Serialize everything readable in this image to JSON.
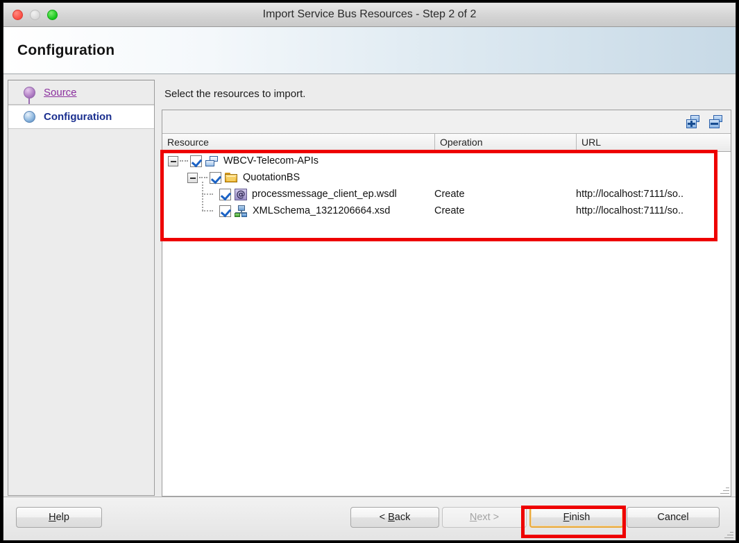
{
  "window": {
    "title": "Import Service Bus Resources - Step 2 of 2",
    "traffic": {
      "close": "close-button",
      "minimize": "minimize-button",
      "maximize": "maximize-button"
    }
  },
  "header": {
    "title": "Configuration"
  },
  "sidebar": {
    "items": [
      {
        "label": "Source",
        "state": "visited",
        "icon": "step-bullet-icon"
      },
      {
        "label": "Configuration",
        "state": "current",
        "icon": "step-bullet-icon"
      }
    ]
  },
  "main": {
    "instruction": "Select the resources to import.",
    "toolbar": [
      {
        "name": "select-all-button",
        "icon": "add-squares-icon",
        "tooltip": "Select All"
      },
      {
        "name": "deselect-all-button",
        "icon": "remove-squares-icon",
        "tooltip": "Deselect All"
      }
    ],
    "columns": [
      "Resource",
      "Operation",
      "URL"
    ],
    "rows": [
      {
        "level": 0,
        "expanded": true,
        "checked": true,
        "icon": "application-icon",
        "resource": "WBCV-Telecom-APIs",
        "operation": "",
        "url": ""
      },
      {
        "level": 1,
        "expanded": true,
        "checked": true,
        "icon": "folder-icon",
        "resource": "QuotationBS",
        "operation": "",
        "url": ""
      },
      {
        "level": 2,
        "expanded": null,
        "checked": true,
        "icon": "wsdl-at-icon",
        "resource": "processmessage_client_ep.wsdl",
        "operation": "Create",
        "url": "http://localhost:7111/so.."
      },
      {
        "level": 2,
        "expanded": null,
        "checked": true,
        "icon": "xml-schema-icon",
        "resource": "XMLSchema_1321206664.xsd",
        "operation": "Create",
        "url": "http://localhost:7111/so.."
      }
    ]
  },
  "footer": {
    "buttons": [
      {
        "name": "help-button",
        "pre": "H",
        "mnemonic": "",
        "post": "elp",
        "full": "Help",
        "state": "enabled"
      },
      {
        "name": "back-button",
        "pre": "< ",
        "mnemonic": "B",
        "post": "ack",
        "full": "< Back",
        "state": "enabled"
      },
      {
        "name": "next-button",
        "pre": "",
        "mnemonic": "N",
        "post": "ext >",
        "full": "Next >",
        "state": "disabled"
      },
      {
        "name": "finish-button",
        "pre": "",
        "mnemonic": "F",
        "post": "inish",
        "full": "Finish",
        "state": "focused"
      },
      {
        "name": "cancel-button",
        "pre": "",
        "mnemonic": "",
        "post": "Cancel",
        "full": "Cancel",
        "state": "enabled"
      }
    ],
    "help_label_pre": "",
    "help_label_mn": "H",
    "help_label_post": "elp",
    "back_label_pre": "< ",
    "back_label_mn": "B",
    "back_label_post": "ack",
    "next_label_pre": "",
    "next_label_mn": "N",
    "next_label_post": "ext >",
    "finish_label_pre": "",
    "finish_label_mn": "F",
    "finish_label_post": "inish",
    "cancel_label": "Cancel"
  },
  "annotations": {
    "color": "#ee0000",
    "boxes": [
      {
        "name": "tree-highlight",
        "target": "resource-tree"
      },
      {
        "name": "finish-highlight",
        "target": "finish-button"
      }
    ]
  }
}
